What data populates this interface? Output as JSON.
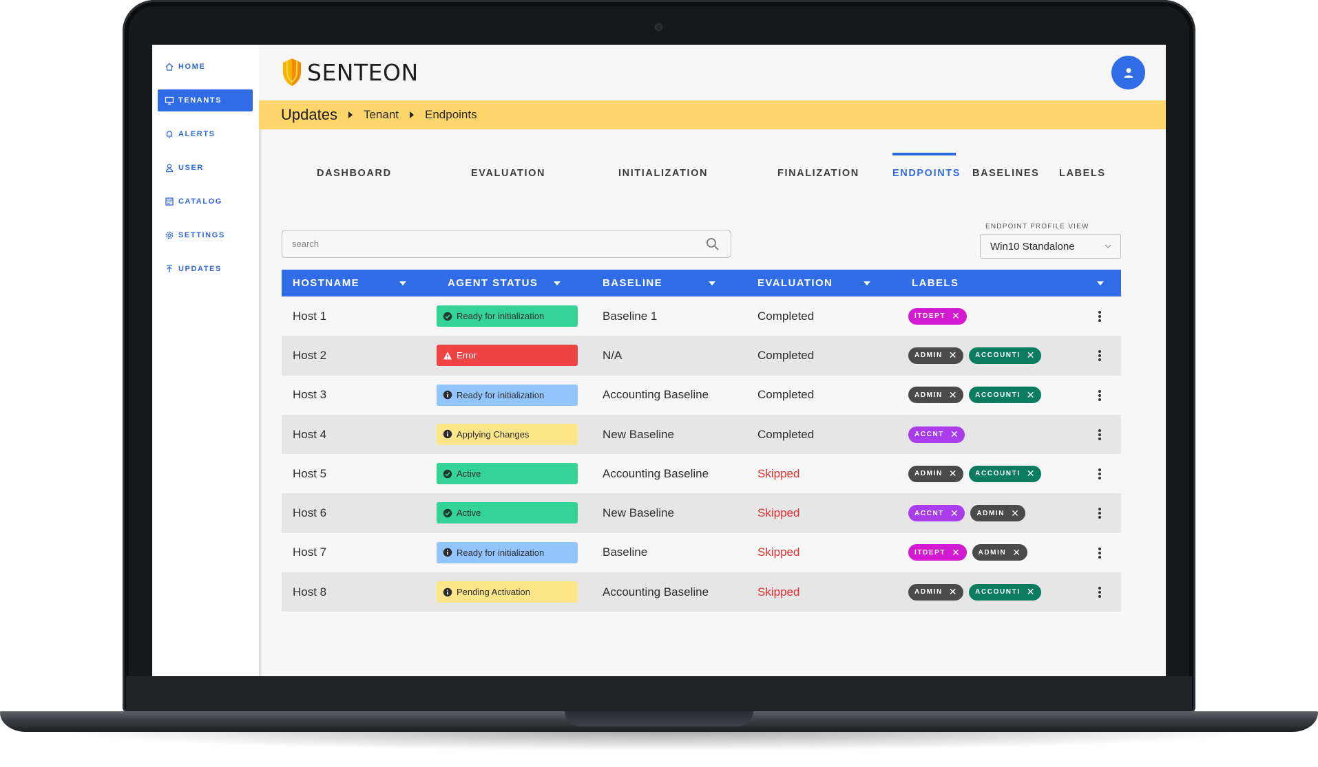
{
  "sidebar": {
    "items": [
      {
        "label": "HOME",
        "icon": "home-icon"
      },
      {
        "label": "TENANTS",
        "icon": "monitor-icon",
        "active": true
      },
      {
        "label": "ALERTS",
        "icon": "bell-icon"
      },
      {
        "label": "USER",
        "icon": "user-icon"
      },
      {
        "label": "CATALOG",
        "icon": "catalog-icon"
      },
      {
        "label": "SETTINGS",
        "icon": "gear-icon"
      },
      {
        "label": "UPDATES",
        "icon": "upload-icon"
      }
    ]
  },
  "header": {
    "logo_text": "SENTEON",
    "avatar_icon": "user-icon"
  },
  "breadcrumb": {
    "title": "Updates",
    "items": [
      "Tenant",
      "Endpoints"
    ]
  },
  "tabs": [
    {
      "label": "DASHBOARD"
    },
    {
      "label": "EVALUATION"
    },
    {
      "label": "INITIALIZATION"
    },
    {
      "label": "FINALIZATION"
    },
    {
      "label": "ENDPOINTS",
      "active": true
    },
    {
      "label": "BASELINES"
    },
    {
      "label": "LABELS"
    }
  ],
  "search": {
    "placeholder": "search",
    "value": ""
  },
  "profile_view": {
    "label": "ENDPOINT PROFILE VIEW",
    "selected": "Win10 Standalone"
  },
  "table": {
    "columns": [
      "HOSTNAME",
      "AGENT STATUS",
      "BASELINE",
      "EVALUATION",
      "LABELS"
    ],
    "rows": [
      {
        "host": "Host 1",
        "status": "Ready for initialization",
        "status_color": "#36d399",
        "status_icon": "check-circle-icon",
        "baseline": "Baseline 1",
        "evaluation": "Completed",
        "labels": [
          {
            "text": "ITDEPT",
            "color": "#d21bd0"
          }
        ]
      },
      {
        "host": "Host 2",
        "status": "Error",
        "status_color": "#ef4444",
        "status_icon": "warning-icon",
        "baseline": "N/A",
        "evaluation": "Completed",
        "labels": [
          {
            "text": "ADMIN",
            "color": "#4a4a4a"
          },
          {
            "text": "ACCOUNTI",
            "color": "#0b7d5e"
          }
        ]
      },
      {
        "host": "Host 3",
        "status": "Ready for initialization",
        "status_color": "#93c5fd",
        "status_icon": "info-icon",
        "baseline": "Accounting Baseline",
        "evaluation": "Completed",
        "labels": [
          {
            "text": "ADMIN",
            "color": "#4a4a4a"
          },
          {
            "text": "ACCOUNTI",
            "color": "#0b7d5e"
          }
        ]
      },
      {
        "host": "Host 4",
        "status": "Applying Changes",
        "status_color": "#fde68a",
        "status_icon": "info-icon",
        "baseline": "New Baseline",
        "evaluation": "Completed",
        "labels": [
          {
            "text": "ACCNT",
            "color": "#a93dee"
          }
        ]
      },
      {
        "host": "Host 5",
        "status": "Active",
        "status_color": "#36d399",
        "status_icon": "check-circle-icon",
        "baseline": "Accounting Baseline",
        "evaluation": "Skipped",
        "labels": [
          {
            "text": "ADMIN",
            "color": "#4a4a4a"
          },
          {
            "text": "ACCOUNTI",
            "color": "#0b7d5e"
          }
        ]
      },
      {
        "host": "Host 6",
        "status": "Active",
        "status_color": "#36d399",
        "status_icon": "check-circle-icon",
        "baseline": "New Baseline",
        "evaluation": "Skipped",
        "labels": [
          {
            "text": "ACCNT",
            "color": "#a93dee"
          },
          {
            "text": "ADMIN",
            "color": "#4a4a4a"
          }
        ]
      },
      {
        "host": "Host 7",
        "status": "Ready for initialization",
        "status_color": "#93c5fd",
        "status_icon": "info-icon",
        "baseline": "Baseline",
        "evaluation": "Skipped",
        "labels": [
          {
            "text": "ITDEPT",
            "color": "#d21bd0"
          },
          {
            "text": "ADMIN",
            "color": "#4a4a4a"
          }
        ]
      },
      {
        "host": "Host 8",
        "status": "Pending Activation",
        "status_color": "#fde68a",
        "status_icon": "info-icon",
        "baseline": "Accounting Baseline",
        "evaluation": "Skipped",
        "labels": [
          {
            "text": "ADMIN",
            "color": "#4a4a4a"
          },
          {
            "text": "ACCOUNTI",
            "color": "#0b7d5e"
          }
        ]
      }
    ]
  },
  "colors": {
    "accent": "#2f6ce5",
    "breadcrumb_bar": "#fed66b",
    "skipped_text": "#e03030"
  }
}
